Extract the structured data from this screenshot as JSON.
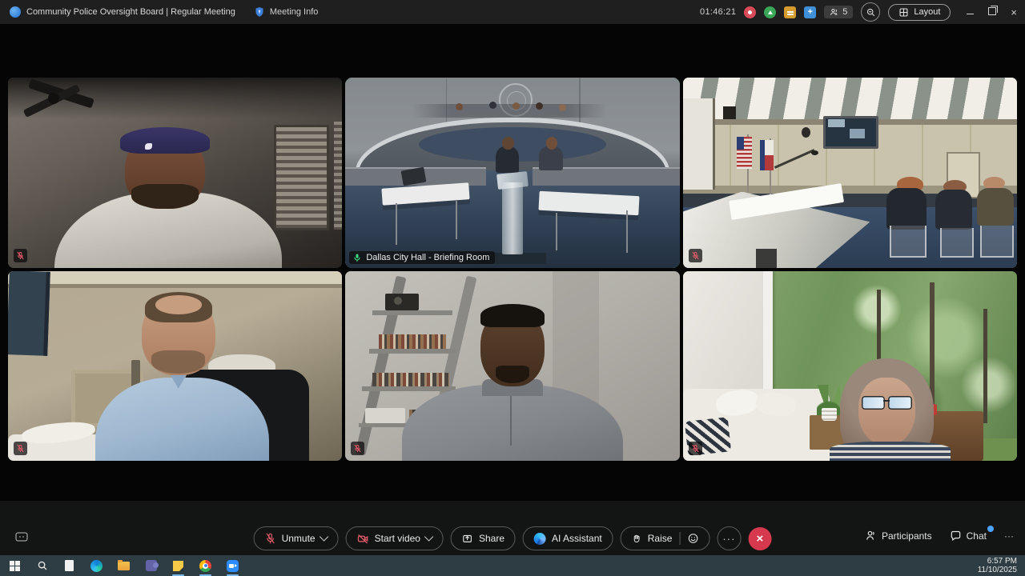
{
  "titlebar": {
    "title": "Community Police Oversight Board | Regular Meeting",
    "meeting_info": "Meeting Info",
    "timer": "01:46:21",
    "participant_count": "5",
    "layout": "Layout"
  },
  "glyphs": {
    "more": "···",
    "close": "×",
    "leave": "×"
  },
  "tiles": [
    {
      "label": "",
      "muted": true
    },
    {
      "label": "Dallas City Hall - Briefing Room",
      "muted": false,
      "active_speaker": true
    },
    {
      "label": "",
      "muted": true
    },
    {
      "label": "",
      "muted": true
    },
    {
      "label": "",
      "muted": true
    },
    {
      "label": "",
      "muted": true
    }
  ],
  "toolbar": {
    "unmute": "Unmute",
    "start_video": "Start video",
    "share": "Share",
    "ai_assistant": "AI Assistant",
    "raise": "Raise",
    "participants": "Participants",
    "chat": "Chat"
  },
  "taskbar": {
    "time": "6:57 PM",
    "date": "11/10/2025"
  },
  "colors": {
    "active_green": "#3ddc84",
    "mic_on_green": "#35c25e",
    "muted_red": "#e05a68",
    "leave_red": "#d6384e",
    "chat_badge": "#4da3ff",
    "taskbar_bg": "#2e3d43",
    "shield_blue": "#3d7fd9"
  }
}
